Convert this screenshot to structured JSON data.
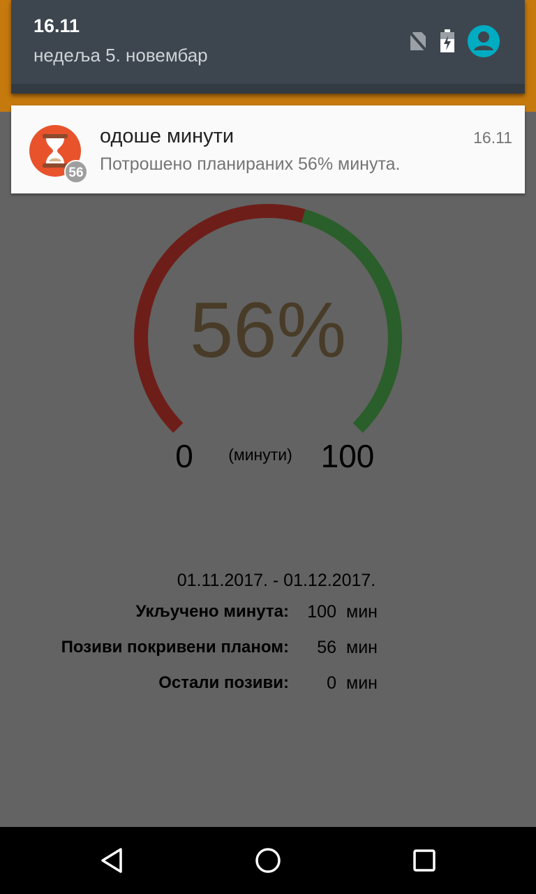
{
  "shade": {
    "time": "16.11",
    "date": "недеља 5. новембар",
    "icons": [
      "no-sim-icon",
      "battery-charging-icon",
      "account-icon"
    ]
  },
  "notification": {
    "app_icon": "hourglass-icon",
    "badge": "56",
    "title": "одоше минути",
    "time": "16.11",
    "text": "Потрошено планираних 56% минута."
  },
  "gauge": {
    "value_text": "56%",
    "value": 56,
    "min": "0",
    "max": "100",
    "unit": "(минути)",
    "used_color": "#6e1e19",
    "remaining_color": "#2a5e2a"
  },
  "stats": {
    "period": "01.11.2017. - 01.12.2017.",
    "rows": [
      {
        "label": "Укључено минута:",
        "value": "100",
        "unit": "мин"
      },
      {
        "label": "Позиви покривени планом:",
        "value": "56",
        "unit": "мин"
      },
      {
        "label": "Остали позиви:",
        "value": "0",
        "unit": "мин"
      }
    ]
  },
  "nav": {
    "buttons": [
      "back-icon",
      "home-icon",
      "recents-icon"
    ]
  }
}
